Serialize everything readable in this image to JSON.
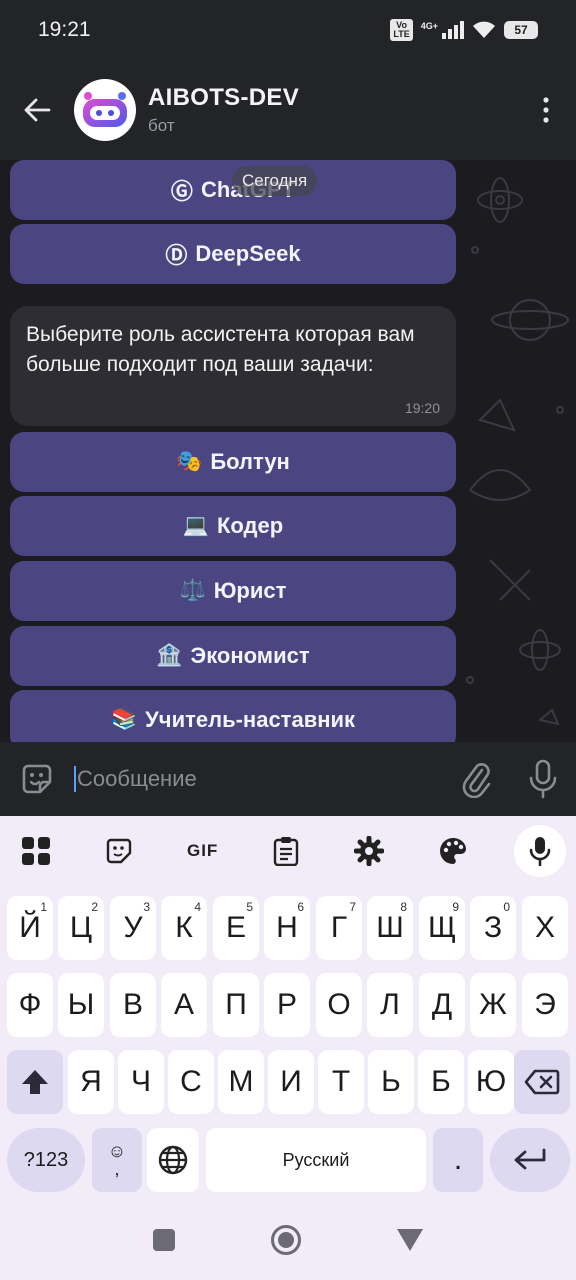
{
  "status_bar": {
    "time": "19:21",
    "volte_top": "Vo",
    "volte_bottom": "LTE",
    "network": "4G+",
    "battery": "57"
  },
  "header": {
    "title": "AIBOTS-DEV",
    "subtitle": "бот"
  },
  "chat": {
    "date_pill": "Сегодня",
    "model_buttons": [
      {
        "icon": "Ⓖ",
        "label": "ChatGPT"
      },
      {
        "icon": "Ⓓ",
        "label": "DeepSeek"
      }
    ],
    "message": {
      "text": "Выберите роль ассистента которая вам больше подходит под ваши задачи:",
      "time": "19:20"
    },
    "role_buttons": [
      {
        "emoji": "🎭",
        "label": "Болтун"
      },
      {
        "emoji": "💻",
        "label": "Кодер"
      },
      {
        "emoji": "⚖️",
        "label": "Юрист"
      },
      {
        "emoji": "🏦",
        "label": "Экономист"
      },
      {
        "emoji": "📚",
        "label": "Учитель-наставник"
      }
    ]
  },
  "input": {
    "placeholder": "Сообщение"
  },
  "keyboard": {
    "toolbar": {
      "gif": "GIF"
    },
    "row1": [
      {
        "k": "Й",
        "s": "1"
      },
      {
        "k": "Ц",
        "s": "2"
      },
      {
        "k": "У",
        "s": "3"
      },
      {
        "k": "К",
        "s": "4"
      },
      {
        "k": "Е",
        "s": "5"
      },
      {
        "k": "Н",
        "s": "6"
      },
      {
        "k": "Г",
        "s": "7"
      },
      {
        "k": "Ш",
        "s": "8"
      },
      {
        "k": "Щ",
        "s": "9"
      },
      {
        "k": "З",
        "s": "0"
      },
      {
        "k": "Х",
        "s": ""
      }
    ],
    "row2": [
      "Ф",
      "Ы",
      "В",
      "А",
      "П",
      "Р",
      "О",
      "Л",
      "Д",
      "Ж",
      "Э"
    ],
    "row3": [
      "Я",
      "Ч",
      "С",
      "М",
      "И",
      "Т",
      "Ь",
      "Б",
      "Ю"
    ],
    "symbols_label": "?123",
    "emoji_top": "☺",
    "comma": ",",
    "space_label": "Русский",
    "period": "."
  },
  "colors": {
    "button_bg": "#4b4682",
    "bubble_bg": "#2d2d33",
    "keyboard_bg": "#f1ecf7",
    "accent": "#5aa0ff"
  }
}
